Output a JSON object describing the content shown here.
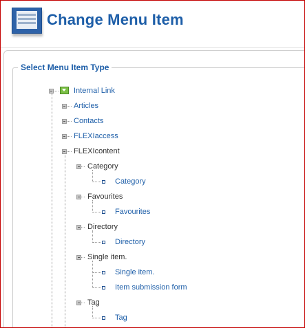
{
  "header": {
    "title": "Change Menu Item"
  },
  "fieldset": {
    "legend": "Select Menu Item Type"
  },
  "tree": {
    "root": "Internal Link",
    "articles": "Articles",
    "contacts": "Contacts",
    "flexiaccess": "FLEXIaccess",
    "flexicontent": "FLEXIcontent",
    "category_group": "Category",
    "category_leaf": "Category",
    "favourites_group": "Favourites",
    "favourites_leaf": "Favourites",
    "directory_group": "Directory",
    "directory_leaf": "Directory",
    "single_group": "Single item.",
    "single_leaf": "Single item.",
    "submission_leaf": "Item submission form",
    "tag_group": "Tag",
    "tag_leaf": "Tag"
  }
}
